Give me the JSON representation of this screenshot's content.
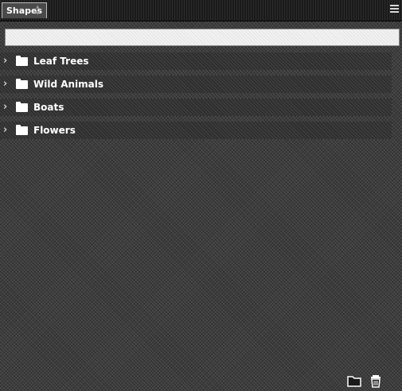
{
  "panel": {
    "tab_label": "Shapes"
  },
  "search": {
    "value": "",
    "placeholder": ""
  },
  "groups": [
    {
      "label": "Leaf Trees",
      "icon": "folder-icon",
      "state": "collapsed"
    },
    {
      "label": "Wild Animals",
      "icon": "folder-icon",
      "state": "collapsed"
    },
    {
      "label": "Boats",
      "icon": "folder-icon",
      "state": "collapsed"
    },
    {
      "label": "Flowers",
      "icon": "folder-icon",
      "state": "collapsed"
    }
  ],
  "footer": {
    "new_group_icon": "folder-icon",
    "delete_icon": "trash-icon"
  }
}
